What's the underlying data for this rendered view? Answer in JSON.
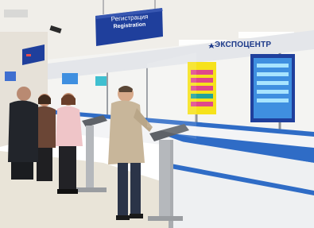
{
  "photo": {
    "signs": {
      "registration_ru": "Регистрация",
      "registration_en": "Registration"
    },
    "logo_text": "ЭКСПОЦЕНТР"
  },
  "colors": {
    "sign_blue": "#1f3f9c",
    "counter_blue": "#2f6cc6",
    "counter_white": "#eef0f2",
    "floor": "#e9e4d8",
    "wall": "#f4f4f2"
  }
}
